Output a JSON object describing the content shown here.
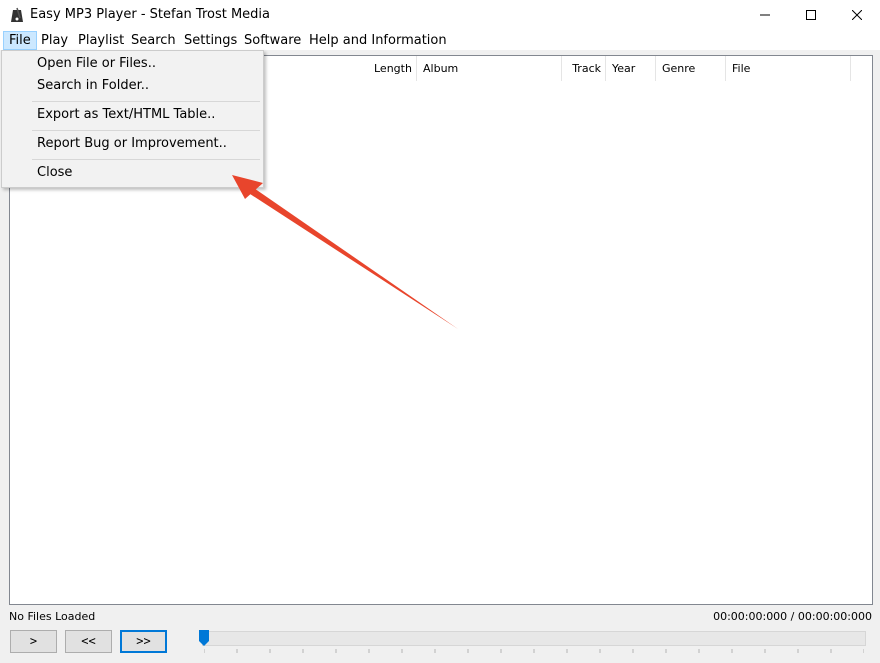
{
  "window": {
    "title": "Easy MP3 Player - Stefan Trost Media"
  },
  "menubar": {
    "items": [
      "File",
      "Play",
      "Playlist",
      "Search",
      "Settings",
      "Software",
      "Help and Information"
    ]
  },
  "file_menu": {
    "items": [
      "Open File or Files..",
      "Search in Folder..",
      "Export as Text/HTML Table..",
      "Report Bug or Improvement..",
      "Close"
    ]
  },
  "list": {
    "columns": [
      "Length",
      "Album",
      "Track",
      "Year",
      "Genre",
      "File"
    ]
  },
  "status": {
    "left": "No Files Loaded",
    "time": "00:00:00:000  /  00:00:00:000"
  },
  "controls": {
    "play": ">",
    "prev": "<<",
    "next": ">>",
    "seek_position": 0
  },
  "colors": {
    "annotation_arrow": "#e8452c",
    "accent": "#0078d7"
  }
}
